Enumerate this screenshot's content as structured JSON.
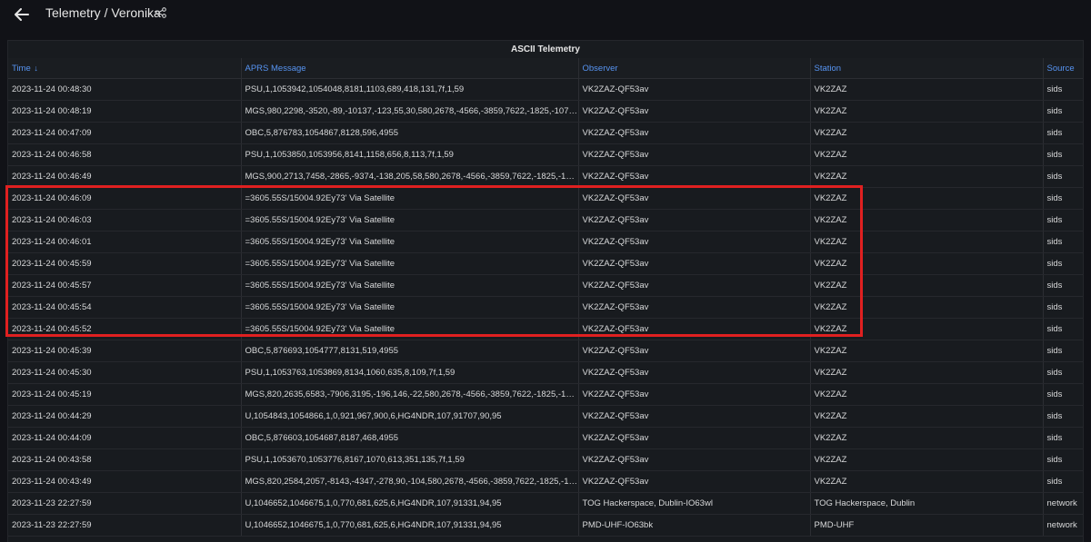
{
  "header": {
    "title": "Telemetry / Veronika",
    "back_icon": "arrow-left-icon",
    "share_icon": "share-icon"
  },
  "panel": {
    "title": "ASCII Telemetry",
    "columns": [
      {
        "label": "Time",
        "sort": "↓"
      },
      {
        "label": "APRS Message"
      },
      {
        "label": "Observer"
      },
      {
        "label": "Station"
      },
      {
        "label": "Source"
      }
    ],
    "rows": [
      [
        "2023-11-24 00:48:30",
        "PSU,1,1053942,1054048,8181,1103,689,418,131,7f,1,59",
        "VK2ZAZ-QF53av",
        "VK2ZAZ",
        "sids"
      ],
      [
        "2023-11-24 00:48:19",
        "MGS,980,2298,-3520,-89,-10137,-123,55,30,580,2678,-4566,-3859,7622,-1825,-1074,...",
        "VK2ZAZ-QF53av",
        "VK2ZAZ",
        "sids"
      ],
      [
        "2023-11-24 00:47:09",
        "OBC,5,876783,1054867,8128,596,4955",
        "VK2ZAZ-QF53av",
        "VK2ZAZ",
        "sids"
      ],
      [
        "2023-11-24 00:46:58",
        "PSU,1,1053850,1053956,8141,1158,656,8,113,7f,1,59",
        "VK2ZAZ-QF53av",
        "VK2ZAZ",
        "sids"
      ],
      [
        "2023-11-24 00:46:49",
        "MGS,900,2713,7458,-2865,-9374,-138,205,58,580,2678,-4566,-3859,7622,-1825,-107...",
        "VK2ZAZ-QF53av",
        "VK2ZAZ",
        "sids"
      ],
      [
        "2023-11-24 00:46:09",
        "=3605.55S/15004.92Ey73' Via Satellite",
        "VK2ZAZ-QF53av",
        "VK2ZAZ",
        "sids"
      ],
      [
        "2023-11-24 00:46:03",
        "=3605.55S/15004.92Ey73' Via Satellite",
        "VK2ZAZ-QF53av",
        "VK2ZAZ",
        "sids"
      ],
      [
        "2023-11-24 00:46:01",
        "=3605.55S/15004.92Ey73' Via Satellite",
        "VK2ZAZ-QF53av",
        "VK2ZAZ",
        "sids"
      ],
      [
        "2023-11-24 00:45:59",
        "=3605.55S/15004.92Ey73' Via Satellite",
        "VK2ZAZ-QF53av",
        "VK2ZAZ",
        "sids"
      ],
      [
        "2023-11-24 00:45:57",
        "=3605.55S/15004.92Ey73' Via Satellite",
        "VK2ZAZ-QF53av",
        "VK2ZAZ",
        "sids"
      ],
      [
        "2023-11-24 00:45:54",
        "=3605.55S/15004.92Ey73' Via Satellite",
        "VK2ZAZ-QF53av",
        "VK2ZAZ",
        "sids"
      ],
      [
        "2023-11-24 00:45:52",
        "=3605.55S/15004.92Ey73' Via Satellite",
        "VK2ZAZ-QF53av",
        "VK2ZAZ",
        "sids"
      ],
      [
        "2023-11-24 00:45:39",
        "OBC,5,876693,1054777,8131,519,4955",
        "VK2ZAZ-QF53av",
        "VK2ZAZ",
        "sids"
      ],
      [
        "2023-11-24 00:45:30",
        "PSU,1,1053763,1053869,8134,1060,635,8,109,7f,1,59",
        "VK2ZAZ-QF53av",
        "VK2ZAZ",
        "sids"
      ],
      [
        "2023-11-24 00:45:19",
        "MGS,820,2635,6583,-7906,3195,-196,146,-22,580,2678,-4566,-3859,7622,-1825,-107...",
        "VK2ZAZ-QF53av",
        "VK2ZAZ",
        "sids"
      ],
      [
        "2023-11-24 00:44:29",
        "U,1054843,1054866,1,0,921,967,900,6,HG4NDR,107,91707,90,95",
        "VK2ZAZ-QF53av",
        "VK2ZAZ",
        "sids"
      ],
      [
        "2023-11-24 00:44:09",
        "OBC,5,876603,1054687,8187,468,4955",
        "VK2ZAZ-QF53av",
        "VK2ZAZ",
        "sids"
      ],
      [
        "2023-11-24 00:43:58",
        "PSU,1,1053670,1053776,8167,1070,613,351,135,7f,1,59",
        "VK2ZAZ-QF53av",
        "VK2ZAZ",
        "sids"
      ],
      [
        "2023-11-24 00:43:49",
        "MGS,820,2584,2057,-8143,-4347,-278,90,-104,580,2678,-4566,-3859,7622,-1825,-107...",
        "VK2ZAZ-QF53av",
        "VK2ZAZ",
        "sids"
      ],
      [
        "2023-11-23 22:27:59",
        "U,1046652,1046675,1,0,770,681,625,6,HG4NDR,107,91331,94,95",
        "TOG Hackerspace, Dublin-IO63wl",
        "TOG Hackerspace, Dublin",
        "network"
      ],
      [
        "2023-11-23 22:27:59",
        "U,1046652,1046675,1,0,770,681,625,6,HG4NDR,107,91331,94,95",
        "PMD-UHF-IO63bk",
        "PMD-UHF",
        "network"
      ]
    ]
  },
  "colors": {
    "background": "#111217",
    "panel": "#181b1f",
    "header_text": "#5794f2",
    "highlight_box": "#e02020"
  }
}
